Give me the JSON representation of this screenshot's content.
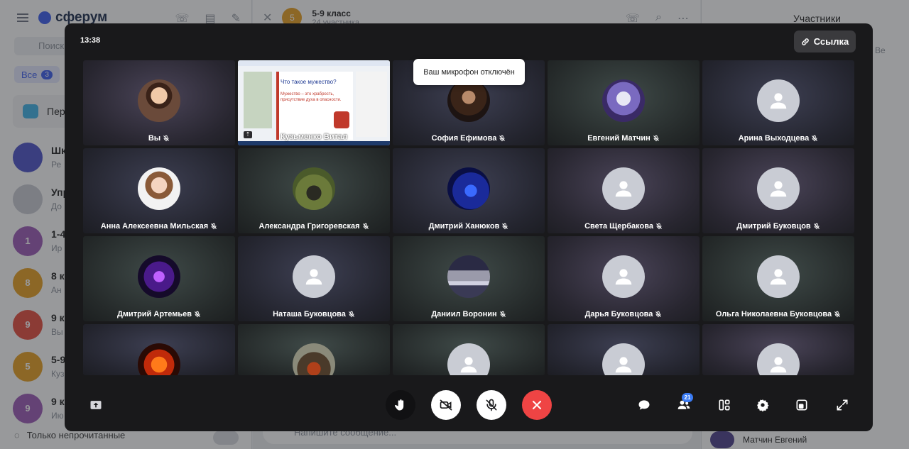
{
  "background": {
    "app_name": "сферум",
    "search_placeholder": "Поиск",
    "filter_label": "Все",
    "filter_count": "3",
    "pinned_label": "Пер",
    "chats": [
      {
        "avatar": "",
        "title": "Шк",
        "sub": "Ре",
        "color": "#4b52c9"
      },
      {
        "avatar": "",
        "title": "Упр",
        "sub": "До",
        "color": "#c9ccd4"
      },
      {
        "avatar": "1",
        "title": "1-4",
        "sub": "Ир",
        "color": "#9b59b6"
      },
      {
        "avatar": "8",
        "title": "8 к",
        "sub": "Ан",
        "color": "#e8a020"
      },
      {
        "avatar": "9",
        "title": "9 к",
        "sub": "Вы",
        "color": "#e74c3c"
      },
      {
        "avatar": "5",
        "title": "5-9",
        "sub": "Куз",
        "color": "#e8a020"
      },
      {
        "avatar": "9",
        "title": "9 к",
        "sub": "Ию",
        "color": "#9b59b6"
      }
    ],
    "unread_only_label": "Только непрочитанные",
    "chat_avatar": "5",
    "chat_title": "5-9 класс",
    "chat_subtitle": "24 участника",
    "compose_placeholder": "Напишите сообщение...",
    "participants_title": "Участники",
    "participants_chip": "Ве",
    "participant_bottom": "Матчин Евгений"
  },
  "call": {
    "time": "13:38",
    "link_label": "Ссылка",
    "mic_off_tooltip": "Ваш микрофон отключён",
    "participants_count": "21",
    "share_tile": {
      "name": "Кузьменко Витал",
      "doc_title": "Что такое мужество?",
      "doc_text": "Мужество – это храбрость, присутствие духа в опасности."
    },
    "tiles": [
      {
        "name": "Вы",
        "photo": "ph-you",
        "tone": "t1"
      },
      {
        "name": "Кузьменко Витал",
        "share": true
      },
      {
        "name": "София Ефимова",
        "photo": "ph-sofia",
        "tone": "t3"
      },
      {
        "name": "Евгений Матчин",
        "photo": "ph-evg",
        "tone": "t2"
      },
      {
        "name": "Арина Выходцева",
        "photo": "",
        "tone": "t3"
      },
      {
        "name": "Анна Алексеевна Мильская",
        "photo": "ph-anna",
        "tone": "t3"
      },
      {
        "name": "Александра Григоревская",
        "photo": "ph-alex",
        "tone": "t2"
      },
      {
        "name": "Дмитрий Ханюков",
        "photo": "ph-dkh",
        "tone": "t3"
      },
      {
        "name": "Света Щербакова",
        "photo": "",
        "tone": "t1"
      },
      {
        "name": "Дмитрий Буковцов",
        "photo": "",
        "tone": "t1"
      },
      {
        "name": "Дмитрий Артемьев",
        "photo": "ph-dart",
        "tone": "t2"
      },
      {
        "name": "Наташа Буковцова",
        "photo": "",
        "tone": "t3"
      },
      {
        "name": "Даниил Воронин",
        "photo": "ph-dan",
        "tone": "t2"
      },
      {
        "name": "Дарья Буковцова",
        "photo": "",
        "tone": "t1"
      },
      {
        "name": "Ольга Николаевна Буковцова",
        "photo": "",
        "tone": "t2"
      },
      {
        "name": "",
        "photo": "ph-orange",
        "tone": "t3"
      },
      {
        "name": "",
        "photo": "ph-moto",
        "tone": "t2"
      },
      {
        "name": "",
        "photo": "",
        "tone": "t2"
      },
      {
        "name": "",
        "photo": "",
        "tone": "t3"
      },
      {
        "name": "",
        "photo": "",
        "tone": "t1"
      }
    ],
    "icons": {
      "share_screen": "share-screen-icon",
      "raise_hand": "raise-hand-icon",
      "camera_off": "camera-off-icon",
      "mic_off": "mic-off-icon",
      "hang_up": "hang-up-icon",
      "chat": "chat-icon",
      "participants": "participants-icon",
      "layout": "layout-icon",
      "settings": "settings-icon",
      "pip": "pip-icon",
      "fullscreen": "fullscreen-icon"
    },
    "colors": {
      "hang_up": "#ef4444",
      "badge": "#3b7cf5",
      "window": "#19191b"
    }
  }
}
